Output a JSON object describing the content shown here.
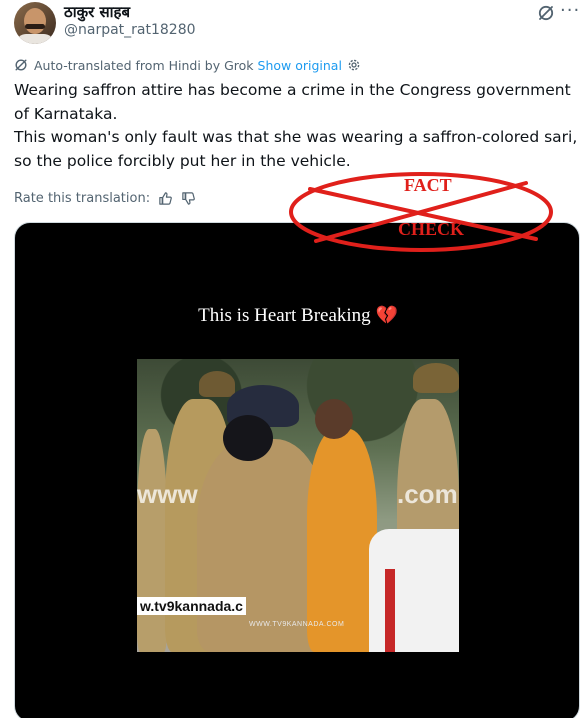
{
  "author": {
    "display_name": "ठाकुर साहब",
    "handle": "@narpat_rat18280"
  },
  "header": {
    "more_icon": "more-dots-icon",
    "grok_icon": "grok-slash-icon"
  },
  "translation": {
    "notice": "Auto-translated from Hindi by Grok",
    "show_original": "Show original",
    "settings_icon": "gear-icon"
  },
  "tweet": {
    "lines": [
      "Wearing saffron attire has become a crime in the Congress government",
      "of Karnataka.",
      "This woman's only fault was that she was wearing a saffron-colored sari,",
      "so the police forcibly put her in the vehicle."
    ]
  },
  "rating": {
    "label": "Rate this translation:",
    "thumbs_up_icon": "thumbs-up-icon",
    "thumbs_down_icon": "thumbs-down-icon"
  },
  "fact_check_stamp": {
    "word_top": "FACT",
    "word_bottom": "CHECK",
    "color": "#e0201b"
  },
  "media": {
    "caption": "This is Heart Breaking",
    "caption_emoji": "💔",
    "watermark_left": "www",
    "watermark_right": ".com",
    "source_tag": "w.tv9kannada.c",
    "small_tag": "WWW.TV9KANNADA.COM"
  }
}
